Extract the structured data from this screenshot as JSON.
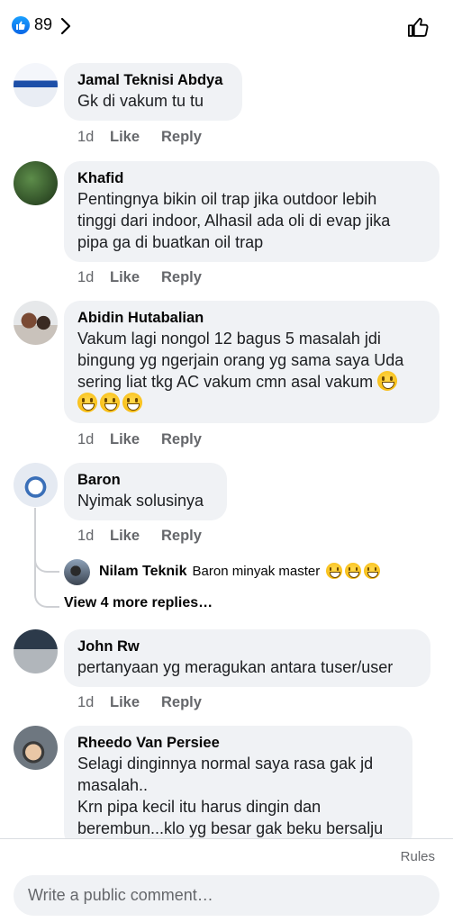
{
  "header": {
    "like_count": "89"
  },
  "comments": [
    {
      "author": "Jamal Teknisi Abdya",
      "lines": [
        "Gk di vakum tu tu"
      ],
      "time": "1d"
    },
    {
      "author": "Khafid",
      "lines": [
        "Pentingnya bikin oil trap jika outdoor lebih",
        "tinggi dari indoor, Alhasil ada oli di evap jika",
        "pipa ga di buatkan oil trap"
      ],
      "time": "1d"
    },
    {
      "author": "Abidin Hutabalian",
      "lines": [
        "Vakum lagi nongol 12 bagus 5 masalah jdi",
        "bingung yg ngerjain orang yg sama saya Uda",
        "sering liat tkg AC vakum cmn asal vakum"
      ],
      "time": "1d"
    },
    {
      "author": "Baron",
      "lines": [
        "Nyimak solusinya"
      ],
      "time": "1d"
    },
    {
      "author": "John Rw",
      "lines": [
        "pertanyaan yg meragukan antara tuser/user"
      ],
      "time": "1d"
    },
    {
      "author": "Rheedo Van Persiee",
      "lines": [
        "Selagi dinginnya normal saya rasa gak jd",
        "masalah..",
        "Krn pipa kecil itu harus dingin dan",
        "berembun...klo yg besar gak beku bersalju"
      ]
    }
  ],
  "actions": {
    "like": "Like",
    "reply": "Reply"
  },
  "reply": {
    "author": "Nilam Teknik",
    "text": "Baron minyak master"
  },
  "view_more": "View 4 more replies…",
  "footer": {
    "rules": "Rules",
    "input_placeholder": "Write a public comment…"
  }
}
